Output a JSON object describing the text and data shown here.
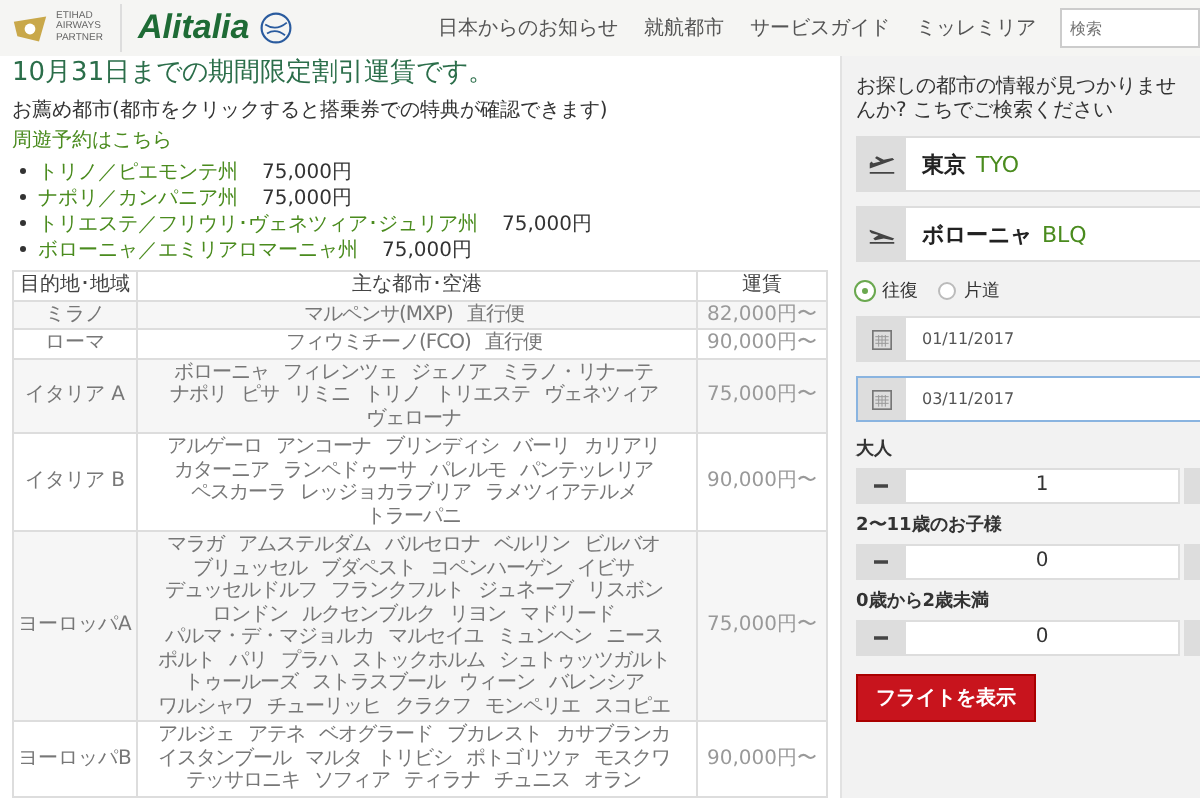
{
  "header": {
    "partner_logo": "ETIHAD AIRWAYS PARTNER",
    "brand_logo": "Alitalia",
    "nav": [
      "日本からのお知らせ",
      "就航都市",
      "サービスガイド",
      "ミッレミリア"
    ],
    "search": {
      "placeholder": "検索"
    }
  },
  "title": "10月31日までの期間限定割引運賃です。",
  "recommend_note": "お薦め都市(都市をクリックすると搭乗券での特典が確認できます)",
  "tour_link": "周遊予約はこちら",
  "offers": [
    {
      "region": "トリノ／ピエモンテ州",
      "price": "75,000円"
    },
    {
      "region": "ナポリ／カンパニア州",
      "price": "75,000円"
    },
    {
      "region": "トリエステ／フリウリ･ヴェネツィア･ジュリア州",
      "price": "75,000円"
    },
    {
      "region": "ボローニャ／エミリアロマーニャ州",
      "price": "75,000円"
    }
  ],
  "table": {
    "columns": [
      "目的地･地域",
      "主な都市･空港",
      "運賃"
    ],
    "rows": [
      {
        "destination": "ミラノ",
        "cities": [
          "マルペンサ(MXP)",
          "直行便"
        ],
        "fare": "82,000円〜"
      },
      {
        "destination": "ローマ",
        "cities": [
          "フィウミチーノ(FCO)",
          "直行便"
        ],
        "fare": "90,000円〜"
      },
      {
        "destination": "イタリア A",
        "cities": [
          "ボローニャ",
          "フィレンツェ",
          "ジェノア",
          "ミラノ・リナーテ",
          "ナポリ",
          "ピサ",
          "リミニ",
          "トリノ",
          "トリエステ",
          "ヴェネツィア",
          "ヴェローナ"
        ],
        "fare": "75,000円〜"
      },
      {
        "destination": "イタリア B",
        "cities": [
          "アルゲーロ",
          "アンコーナ",
          "ブリンディシ",
          "バーリ",
          "カリアリ",
          "カターニア",
          "ランペドゥーサ",
          "パレルモ",
          "パンテッレリア",
          "ペスカーラ",
          "レッジョカラブリア",
          "ラメツィアテルメ",
          "トラーパニ"
        ],
        "fare": "90,000円〜"
      },
      {
        "destination": "ヨーロッパA",
        "cities": [
          "マラガ",
          "アムステルダム",
          "バルセロナ",
          "ベルリン",
          "ビルバオ",
          "ブリュッセル",
          "ブダペスト",
          "コペンハーゲン",
          "イビサ",
          "デュッセルドルフ",
          "フランクフルト",
          "ジュネーブ",
          "リスボン",
          "ロンドン",
          "ルクセンブルク",
          "リヨン",
          "マドリード",
          "パルマ・デ・マジョルカ",
          "マルセイユ",
          "ミュンヘン",
          "ニース",
          "ポルト",
          "パリ",
          "プラハ",
          "ストックホルム",
          "シュトゥッツガルト",
          "トゥールーズ",
          "ストラスブール",
          "ウィーン",
          "バレンシア",
          "ワルシャワ",
          "チューリッヒ",
          "クラクフ",
          "モンペリエ",
          "スコピエ"
        ],
        "fare": "75,000円〜"
      },
      {
        "destination": "ヨーロッパB",
        "cities": [
          "アルジェ",
          "アテネ",
          "ベオグラード",
          "ブカレスト",
          "カサブランカ",
          "イスタンブール",
          "マルタ",
          "トリビシ",
          "ポトゴリツァ",
          "モスクワ",
          "テッサロニキ",
          "ソフィア",
          "ティラナ",
          "チュニス",
          "オラン"
        ],
        "fare": "90,000円〜"
      }
    ]
  },
  "booking": {
    "notice": "お探しの都市の情報が見つかりませんか? こちでご検索ください",
    "airports": [
      {
        "kind": "departure",
        "city": "東京",
        "code": "TYO"
      },
      {
        "kind": "arrival",
        "city": "ボローニャ",
        "code": "BLQ"
      }
    ],
    "trip_types": [
      {
        "label": "往復",
        "selected": true
      },
      {
        "label": "片道",
        "selected": false
      }
    ],
    "dates": [
      {
        "value": "01/11/2017",
        "focused": false
      },
      {
        "value": "03/11/2017",
        "focused": true
      }
    ],
    "passengers": [
      {
        "label": "大人",
        "value": "1"
      },
      {
        "label": "2〜11歳のお子様",
        "value": "0"
      },
      {
        "label": "0歳から2歳未満",
        "value": "0"
      }
    ],
    "submit": "フライトを表示"
  }
}
